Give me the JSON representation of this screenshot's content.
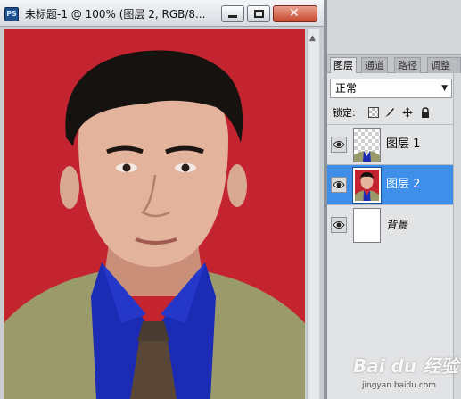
{
  "document": {
    "title": "未标题-1 @ 100% (图层 2, RGB/8...",
    "app_icon": "PS",
    "window_buttons": [
      "minimize-icon",
      "maximize-icon",
      "close-icon"
    ],
    "canvas_background": "#c3242f"
  },
  "layers_panel": {
    "tabs": [
      "图层",
      "通道",
      "路径",
      "调整"
    ],
    "active_tab": "图层",
    "blend_mode": "正常",
    "lock_label": "锁定:",
    "lock_icons": [
      "lock-transparent-pixels-icon",
      "lock-image-pixels-icon",
      "lock-position-icon",
      "lock-all-icon"
    ],
    "layers": [
      {
        "name": "图层 1",
        "visible": true,
        "selected": false
      },
      {
        "name": "图层 2",
        "visible": true,
        "selected": true
      },
      {
        "name": "背景",
        "visible": true,
        "selected": false
      }
    ],
    "selection_color": "#3d8fea"
  },
  "watermark": {
    "logo": "Bai du 经验",
    "url": "jingyan.baidu.com"
  }
}
